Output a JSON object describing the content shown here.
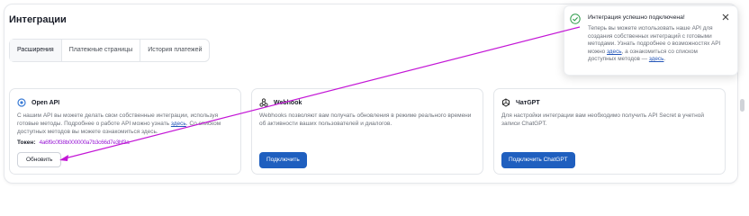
{
  "page": {
    "title": "Интеграции"
  },
  "tabs": [
    {
      "label": "Расширения",
      "active": true
    },
    {
      "label": "Платежные страницы",
      "active": false
    },
    {
      "label": "История платежей",
      "active": false
    }
  ],
  "cards": {
    "openapi": {
      "icon": "open-api-icon",
      "title": "Open API",
      "desc_pre": "С нашим API вы можете делать свои собственные интеграции, используя готовые методы. Подробнее о работе API можно узнать ",
      "desc_link": "здесь",
      "desc_post": ". Со списком доступных методов вы можете ознакомиться здесь.",
      "token_label": "Токен:",
      "token_value": "4a6f9c0f38b000000a7b3c66d7e3bf3a",
      "button": "Обновить"
    },
    "webhook": {
      "icon": "webhook-icon",
      "title": "Webhook",
      "desc": "Webhooks позволяют вам получать обновления в режиме реального времени об активности ваших пользователей и диалогов.",
      "button": "Подключить"
    },
    "chatgpt": {
      "icon": "chatgpt-icon",
      "title": "ЧатGPT",
      "desc": "Для настройки интеграции вам необходимо получить API Secret в учетной записи ChatGPT.",
      "button": "Подключить ChatGPT"
    }
  },
  "toast": {
    "title": "Интеграция успешно подключена!",
    "body_pre": "Теперь вы можете использовать наше API для создания собственных интеграций с готовыми методами. Узнать подробнее о возможностях API можно ",
    "body_link1": "здесь",
    "body_mid": ", а ознакомиться со списком доступных методов — ",
    "body_link2": "здесь",
    "body_post": "."
  },
  "colors": {
    "accent": "#1f5fbf",
    "success": "#2e9c4a",
    "annotation": "#c316d6"
  }
}
